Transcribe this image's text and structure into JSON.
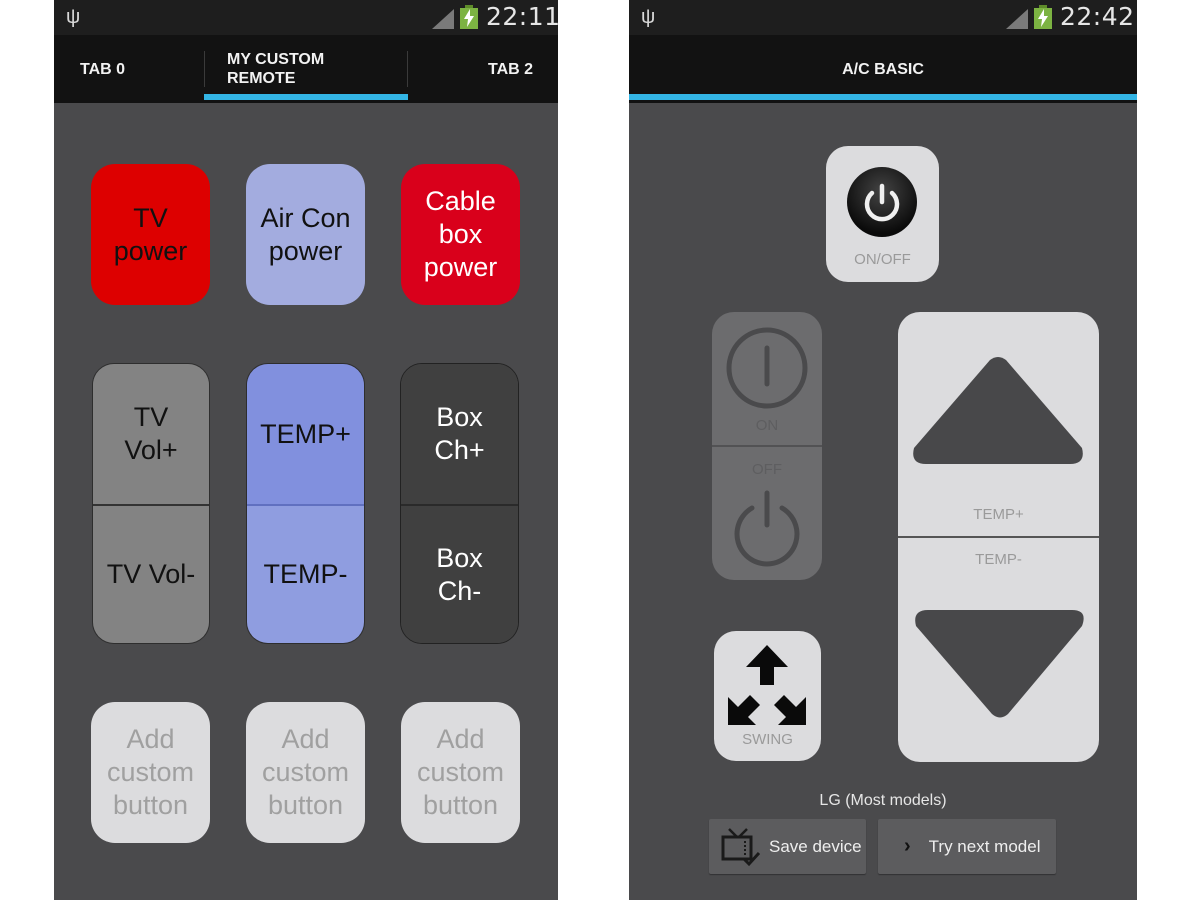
{
  "left_screen": {
    "status_bar": {
      "usb_icon": "usb-icon",
      "signal_icon": "signal-icon",
      "battery_icon": "battery-charging-icon",
      "time": "22:11"
    },
    "tabs": [
      {
        "label": "TAB 0",
        "selected": false
      },
      {
        "label": "MY CUSTOM\nREMOTE",
        "selected": true
      },
      {
        "label": "TAB 2",
        "selected": false
      }
    ],
    "accent_color": "#33b5e5",
    "buttons": {
      "tv_power": {
        "label": "TV\npower",
        "color": "#dd0000",
        "text_color": "#111111"
      },
      "aircon_power": {
        "label": "Air Con\npower",
        "color": "#a3acdf",
        "text_color": "#111111"
      },
      "cable_power": {
        "label": "Cable\nbox\npower",
        "color": "#d9001b",
        "text_color": "#ffffff"
      },
      "tv_vol_up": {
        "label": "TV\nVol+",
        "color": "#838383"
      },
      "tv_vol_down": {
        "label": "TV Vol-",
        "color": "#838383"
      },
      "temp_up": {
        "label": "TEMP+",
        "color": "#8190de"
      },
      "temp_down": {
        "label": "TEMP-",
        "color": "#8f9de0"
      },
      "box_ch_up": {
        "label": "Box\nCh+",
        "color": "#404040"
      },
      "box_ch_down": {
        "label": "Box\nCh-",
        "color": "#404040"
      },
      "add_custom": [
        {
          "label": "Add\ncustom\nbutton"
        },
        {
          "label": "Add\ncustom\nbutton"
        },
        {
          "label": "Add\ncustom\nbutton"
        }
      ]
    }
  },
  "right_screen": {
    "status_bar": {
      "usb_icon": "usb-icon",
      "signal_icon": "signal-icon",
      "battery_icon": "battery-charging-icon",
      "time": "22:42"
    },
    "title": "A/C BASIC",
    "accent_color": "#33b5e5",
    "buttons": {
      "on_off": {
        "label": "ON/OFF",
        "icon": "power-icon"
      },
      "on": {
        "label": "ON",
        "icon": "power-on-icon",
        "enabled": false
      },
      "off": {
        "label": "OFF",
        "icon": "power-off-icon",
        "enabled": false
      },
      "temp_up": {
        "label": "TEMP+",
        "icon": "triangle-up-icon"
      },
      "temp_down": {
        "label": "TEMP-",
        "icon": "triangle-down-icon"
      },
      "swing": {
        "label": "SWING",
        "icon": "swing-arrows-icon"
      }
    },
    "model_label": "LG (Most models)",
    "save_device": {
      "label": "Save device",
      "icon": "tv-check-icon"
    },
    "try_next": {
      "label": "Try next model",
      "icon": "chevron-right-icon"
    }
  }
}
